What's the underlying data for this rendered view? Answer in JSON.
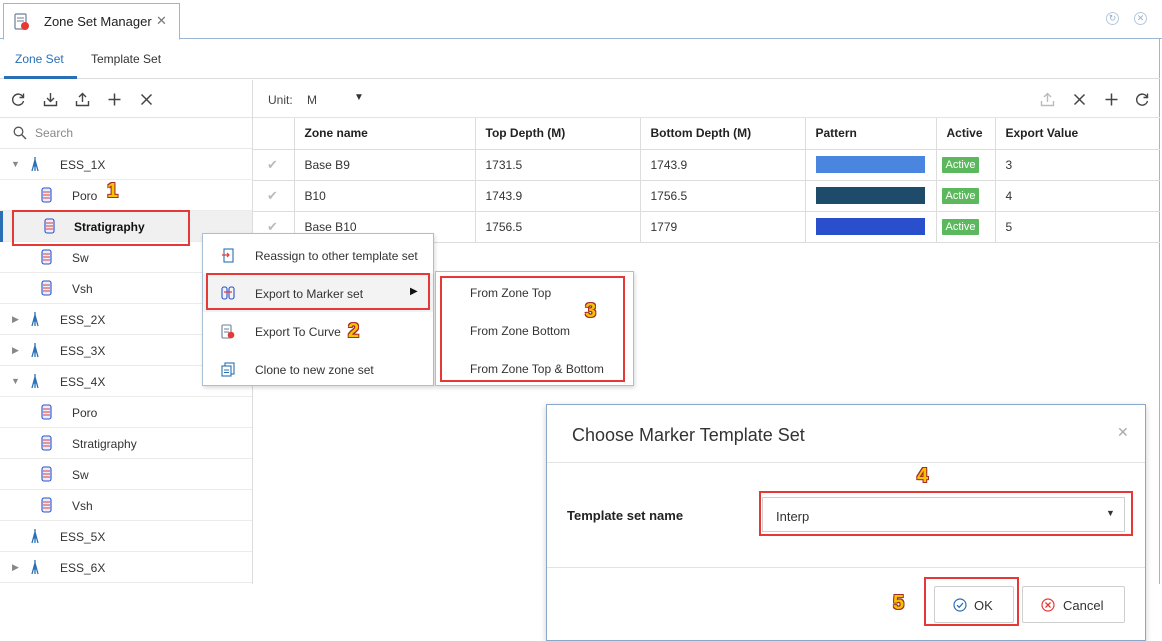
{
  "window": {
    "tab_title": "Zone Set Manager",
    "tab_close": "✕"
  },
  "subtabs": [
    {
      "label": "Zone Set",
      "active": true
    },
    {
      "label": "Template Set",
      "active": false
    }
  ],
  "left_toolbar": {
    "icons": [
      "refresh-icon",
      "import-icon",
      "export-icon",
      "add-icon",
      "close-icon"
    ]
  },
  "search": {
    "placeholder": "Search"
  },
  "tree": [
    {
      "label": "ESS_1X",
      "type": "well",
      "expanded": true
    },
    {
      "label": "Poro",
      "type": "zone-set"
    },
    {
      "label": "Stratigraphy",
      "type": "zone-set",
      "selected": true
    },
    {
      "label": "Sw",
      "type": "zone-set"
    },
    {
      "label": "Vsh",
      "type": "zone-set"
    },
    {
      "label": "ESS_2X",
      "type": "well",
      "expanded": false
    },
    {
      "label": "ESS_3X",
      "type": "well",
      "expanded": false
    },
    {
      "label": "ESS_4X",
      "type": "well",
      "expanded": true
    },
    {
      "label": "Poro",
      "type": "zone-set"
    },
    {
      "label": "Stratigraphy",
      "type": "zone-set"
    },
    {
      "label": "Sw",
      "type": "zone-set"
    },
    {
      "label": "Vsh",
      "type": "zone-set"
    },
    {
      "label": "ESS_5X",
      "type": "well",
      "expanded": false
    },
    {
      "label": "ESS_6X",
      "type": "well",
      "expanded": false
    }
  ],
  "right_toolbar": {
    "unit_label": "Unit:",
    "unit_value": "M",
    "icons": [
      "upload-icon",
      "close-icon",
      "add-icon",
      "refresh-icon"
    ]
  },
  "grid": {
    "columns": [
      "Zone name",
      "Top Depth (M)",
      "Bottom Depth (M)",
      "Pattern",
      "Active",
      "Export Value"
    ],
    "rows": [
      {
        "zone_name": "Base B9",
        "top": "1731.5",
        "bottom": "1743.9",
        "color": "#4a86e0",
        "active": "Active",
        "export_value": "3"
      },
      {
        "zone_name": "B10",
        "top": "1743.9",
        "bottom": "1756.5",
        "color": "#1f4b6a",
        "active": "Active",
        "export_value": "4"
      },
      {
        "zone_name": "Base B10",
        "top": "1756.5",
        "bottom": "1779",
        "color": "#2a4fcc",
        "active": "Active",
        "export_value": "5"
      }
    ]
  },
  "context_menu": [
    {
      "label": "Reassign to other template set",
      "icon": "reassign-icon"
    },
    {
      "label": "Export to Marker set",
      "icon": "marker-export-icon",
      "has_submenu": true
    },
    {
      "label": "Export To Curve",
      "icon": "curve-export-icon"
    },
    {
      "label": "Clone to new zone set",
      "icon": "clone-icon"
    }
  ],
  "submenu": [
    {
      "label": "From Zone Top"
    },
    {
      "label": "From Zone Bottom"
    },
    {
      "label": "From Zone Top & Bottom"
    }
  ],
  "callouts": [
    "1",
    "2",
    "3",
    "4",
    "5"
  ],
  "dialog": {
    "title": "Choose Marker Template Set",
    "close": "✕",
    "field_label": "Template set name",
    "field_value": "Interp",
    "ok_label": "OK",
    "cancel_label": "Cancel"
  },
  "colors": {
    "accent": "#2a6fb5",
    "highlight_box": "#e53935",
    "callout": "#f5c400",
    "active_badge": "#5cb85c"
  }
}
